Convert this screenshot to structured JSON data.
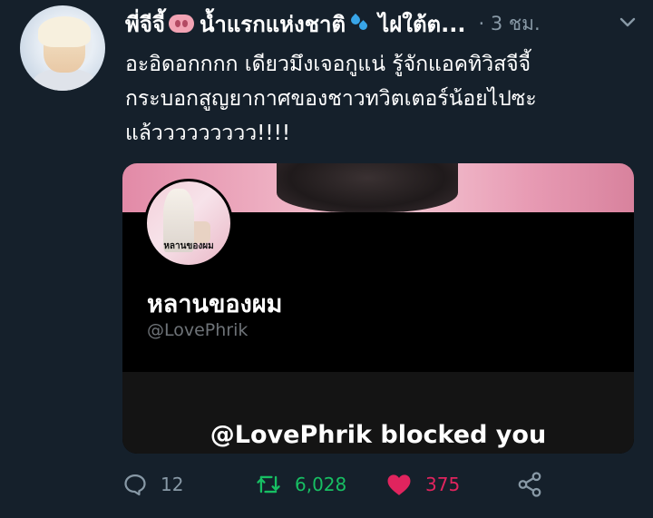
{
  "tweet": {
    "display_name": "พี่จีจี้",
    "display_name_part2": "น้ำแรกแห่งชาติ",
    "display_name_part3": "ไฝใต้ต...",
    "time": "· 3 ชม.",
    "text_lines": [
      "อะอิดอกกกก เดียวมึงเจอกูแน่ รู้จักแอคทิวิสจีจี้",
      "กระบอกสูญยากาศของชาวทวิตเตอร์น้อยไปซะ",
      "แล้ววววววววว!!!!"
    ]
  },
  "blocked_card": {
    "avatar_caption": "หลานของผม",
    "profile_name": "หลานของผม",
    "profile_handle": "@LovePhrik",
    "message": "@LovePhrik blocked you"
  },
  "actions": {
    "reply_count": "12",
    "retweet_count": "6,028",
    "like_count": "375"
  },
  "colors": {
    "background": "#15202b",
    "muted_text": "#8899a6",
    "retweet_green": "#17bf63",
    "like_red": "#e0245e"
  },
  "icons": [
    "pig-icon",
    "droplets-icon",
    "chevron-down-icon",
    "reply-icon",
    "retweet-icon",
    "heart-icon",
    "share-icon"
  ]
}
